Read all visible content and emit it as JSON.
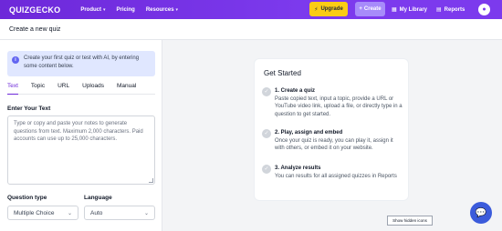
{
  "header": {
    "logo": "QUIZGECKO",
    "nav": [
      {
        "label": "Product"
      },
      {
        "label": "Pricing"
      },
      {
        "label": "Resources"
      }
    ],
    "upgrade_label": "Upgrade",
    "create_label": "Create",
    "library_label": "My Library",
    "reports_label": "Reports"
  },
  "page": {
    "title": "Create a new quiz"
  },
  "left": {
    "info": "Create your first quiz or test with AI, by entering some content below.",
    "tabs": [
      {
        "label": "Text",
        "active": true
      },
      {
        "label": "Topic"
      },
      {
        "label": "URL"
      },
      {
        "label": "Uploads"
      },
      {
        "label": "Manual"
      }
    ],
    "text_label": "Enter Your Text",
    "text_placeholder": "Type or copy and paste your notes to generate questions from text. Maximum 2,000 characters. Paid accounts can use up to 25,000 characters.",
    "question_type_label": "Question type",
    "question_type_value": "Multiple Choice",
    "language_label": "Language",
    "language_value": "Auto"
  },
  "card": {
    "title": "Get Started",
    "steps": [
      {
        "title": "1. Create a quiz",
        "body": "Paste copied text, input a topic, provide a URL or YouTube video link, upload a file, or directly type in a question to get started."
      },
      {
        "title": "2. Play, assign and embed",
        "body": "Once your quiz is ready, you can play it, assign it with others, or embed it on your website."
      },
      {
        "title": "3. Analyze results",
        "body": "You can results for all assigned quizzes in Reports"
      }
    ]
  },
  "tooltip": "Show hidden icons",
  "colors": {
    "brand": "#7c3aed",
    "upgrade": "#facc15",
    "chat": "#3b5bdb"
  }
}
